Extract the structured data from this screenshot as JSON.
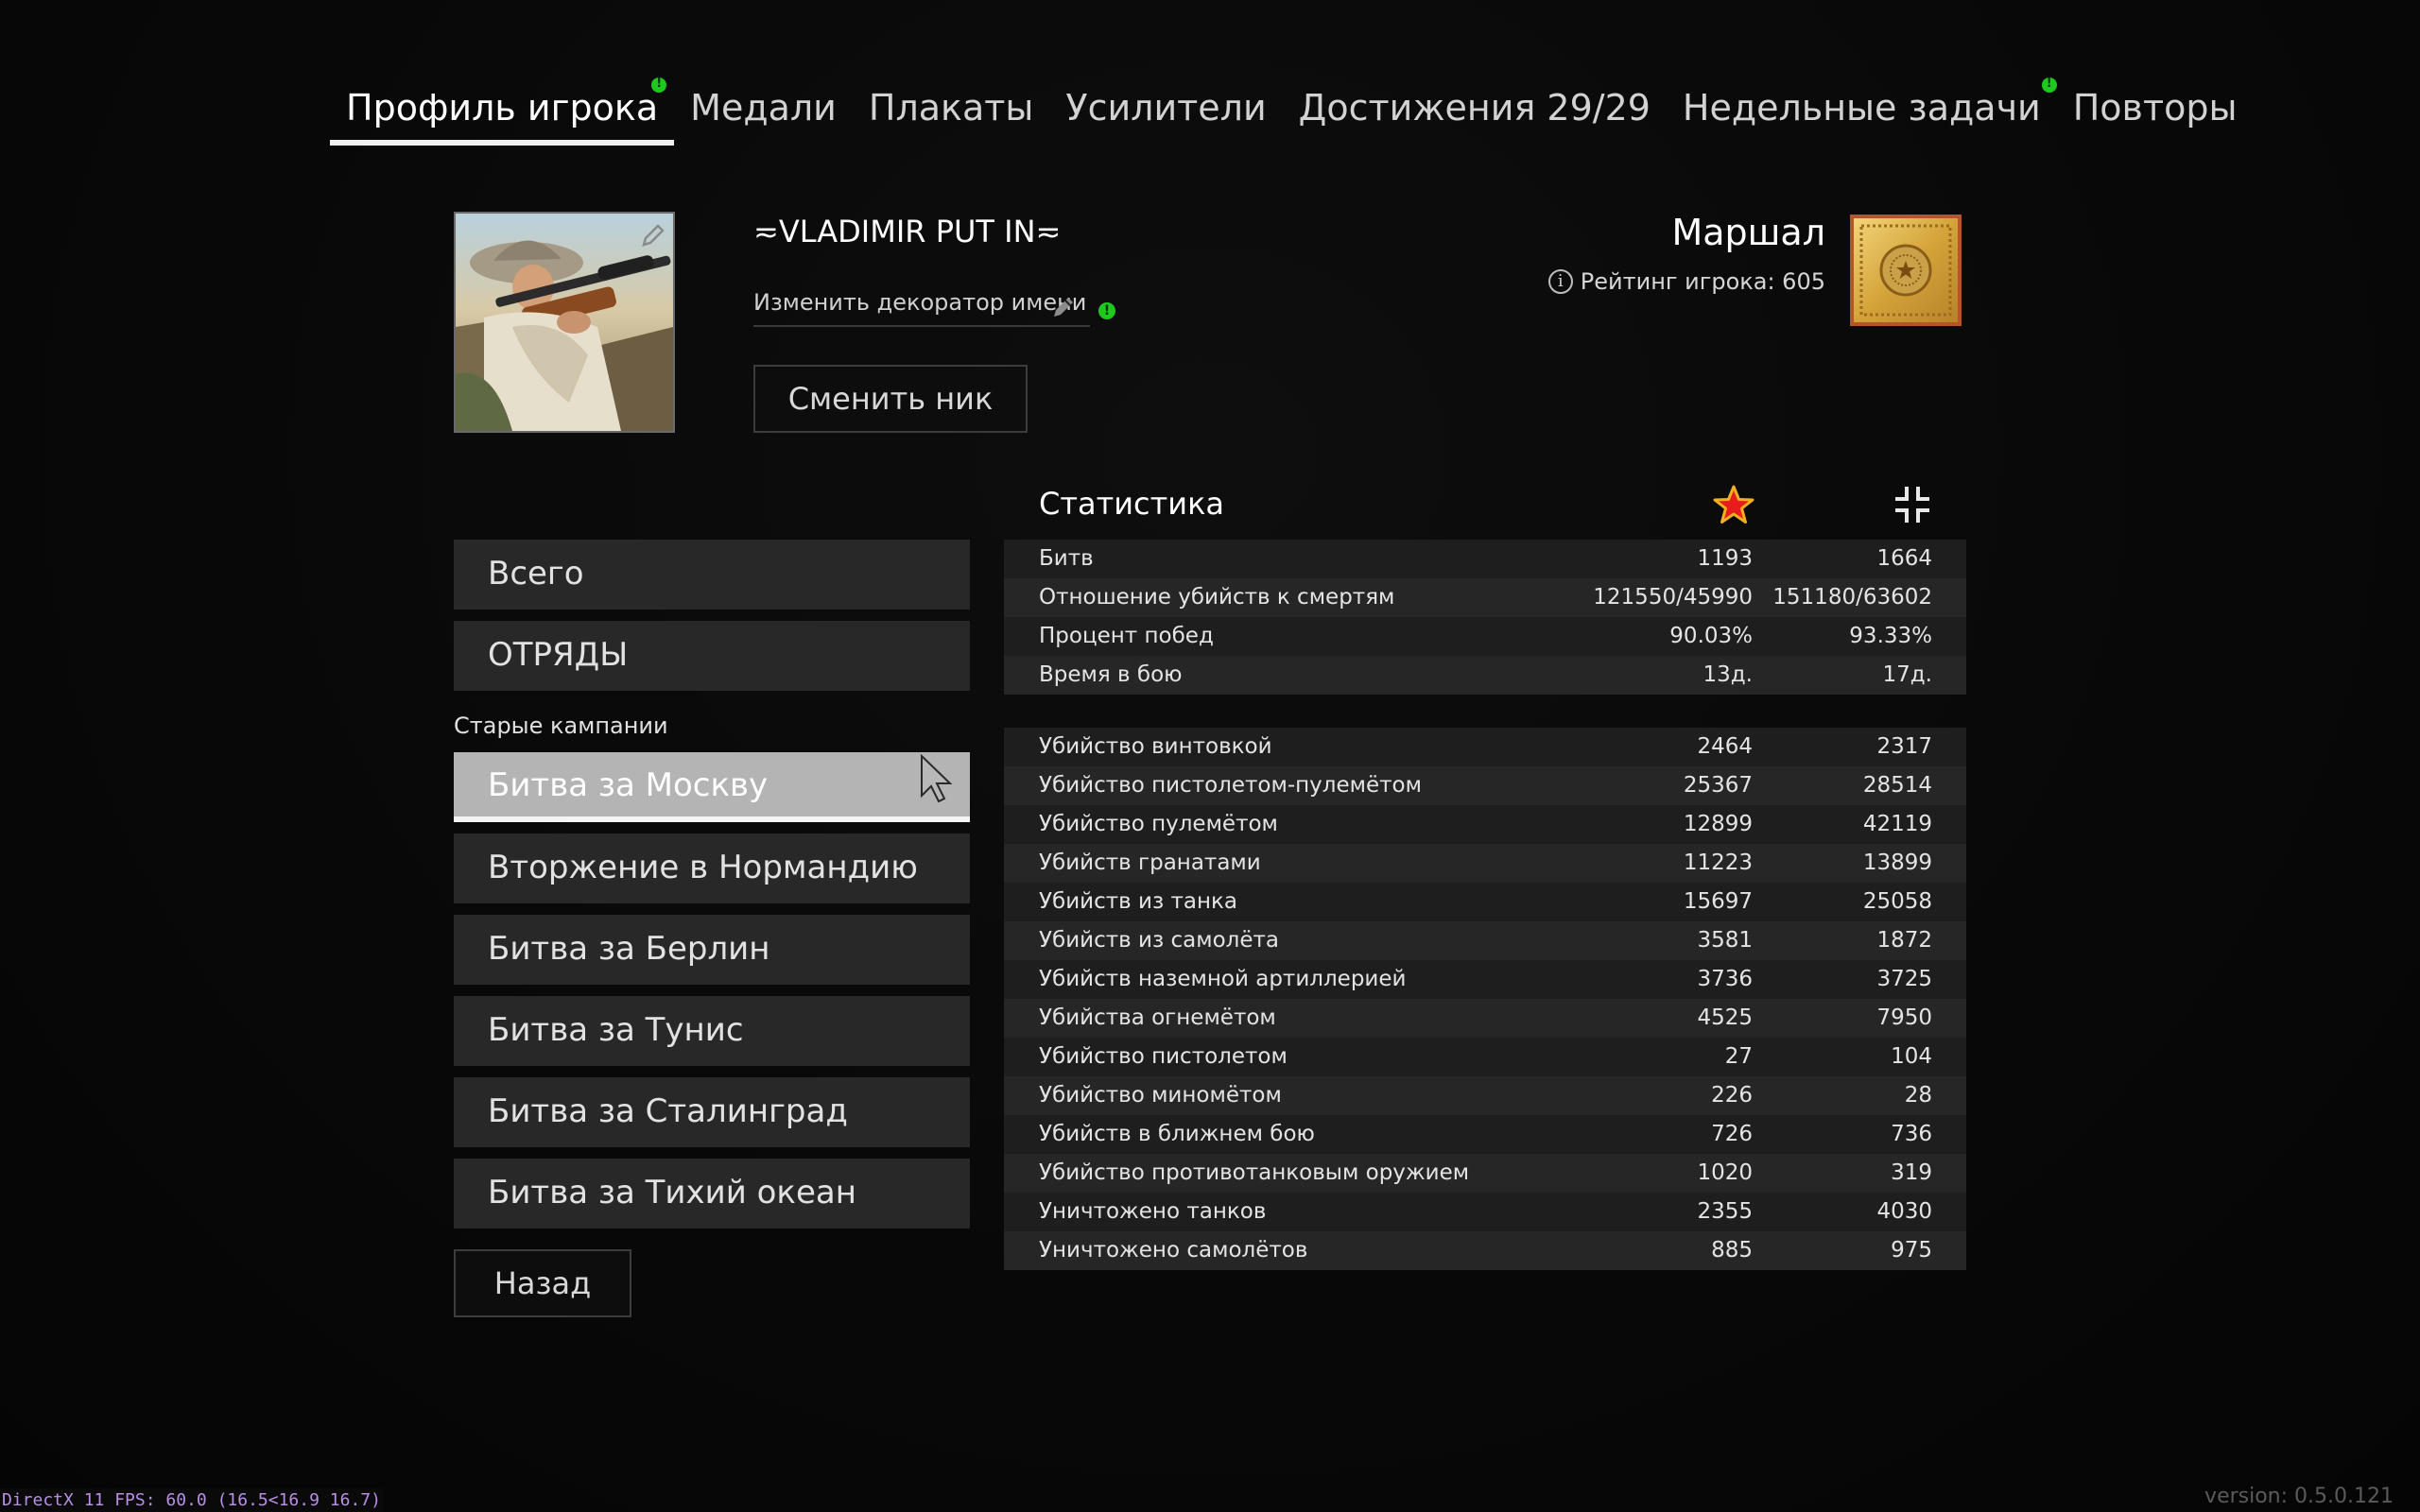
{
  "tabs": [
    {
      "label": "Профиль игрока",
      "active": true,
      "notify": true
    },
    {
      "label": "Медали",
      "active": false,
      "notify": false
    },
    {
      "label": "Плакаты",
      "active": false,
      "notify": false
    },
    {
      "label": "Усилители",
      "active": false,
      "notify": false
    },
    {
      "label": "Достижения 29/29",
      "active": false,
      "notify": false
    },
    {
      "label": "Недельные задачи",
      "active": false,
      "notify": true
    },
    {
      "label": "Повторы",
      "active": false,
      "notify": false
    }
  ],
  "profile": {
    "nickname": "≂VLADIMIR PUT IN≂",
    "decorator_label": "Изменить декоратор имени",
    "change_nick_label": "Сменить ник",
    "rank_name": "Маршал",
    "rating_label": "Рейтинг игрока: 605",
    "avatar_icon": "soldier-with-rifle-portrait",
    "rank_icon": "gold-star-rank-icon"
  },
  "menu": {
    "top_items": [
      "Всего",
      "ОТРЯДЫ"
    ],
    "campaigns_label": "Старые кампании",
    "campaigns": [
      {
        "label": "Битва за Москву",
        "selected": true
      },
      {
        "label": "Вторжение в Нормандию",
        "selected": false
      },
      {
        "label": "Битва за Берлин",
        "selected": false
      },
      {
        "label": "Битва за Тунис",
        "selected": false
      },
      {
        "label": "Битва за Сталинград",
        "selected": false
      },
      {
        "label": "Битва за Тихий океан",
        "selected": false
      }
    ],
    "back_label": "Назад"
  },
  "stats": {
    "title": "Статистика",
    "column_icons": [
      "red-star-icon",
      "collapse-arrows-icon"
    ],
    "summary": [
      {
        "label": "Битв",
        "v1": "1193",
        "v2": "1664"
      },
      {
        "label": "Отношение убийств к смертям",
        "v1": "121550/45990",
        "v2": "151180/63602"
      },
      {
        "label": "Процент побед",
        "v1": "90.03%",
        "v2": "93.33%"
      },
      {
        "label": "Время в бою",
        "v1": "13д.",
        "v2": "17д."
      }
    ],
    "kills": [
      {
        "label": "Убийство винтовкой",
        "v1": "2464",
        "v2": "2317"
      },
      {
        "label": "Убийство пистолетом-пулемётом",
        "v1": "25367",
        "v2": "28514"
      },
      {
        "label": "Убийство пулемётом",
        "v1": "12899",
        "v2": "42119"
      },
      {
        "label": "Убийств гранатами",
        "v1": "11223",
        "v2": "13899"
      },
      {
        "label": "Убийств из танка",
        "v1": "15697",
        "v2": "25058"
      },
      {
        "label": "Убийств из самолёта",
        "v1": "3581",
        "v2": "1872"
      },
      {
        "label": "Убийств наземной артиллерией",
        "v1": "3736",
        "v2": "3725"
      },
      {
        "label": "Убийства огнемётом",
        "v1": "4525",
        "v2": "7950"
      },
      {
        "label": "Убийство пистолетом",
        "v1": "27",
        "v2": "104"
      },
      {
        "label": "Убийство миномётом",
        "v1": "226",
        "v2": "28"
      },
      {
        "label": "Убийств в ближнем бою",
        "v1": "726",
        "v2": "736"
      },
      {
        "label": "Убийство противотанковым оружием",
        "v1": "1020",
        "v2": "319"
      },
      {
        "label": "Уничтожено танков",
        "v1": "2355",
        "v2": "4030"
      },
      {
        "label": "Уничтожено самолётов",
        "v1": "885",
        "v2": "975"
      }
    ]
  },
  "debug": {
    "fps": "DirectX 11 FPS: 60.0 (16.5<16.9 16.7)",
    "version": "version: 0.5.0.121"
  },
  "colors": {
    "notify_dot": "#1ec81e",
    "row_odd": "#1e1e1e",
    "row_even": "#262626",
    "menu_bg": "#282828",
    "menu_selected": "#b4b4b4",
    "star": "#e81c1c"
  }
}
